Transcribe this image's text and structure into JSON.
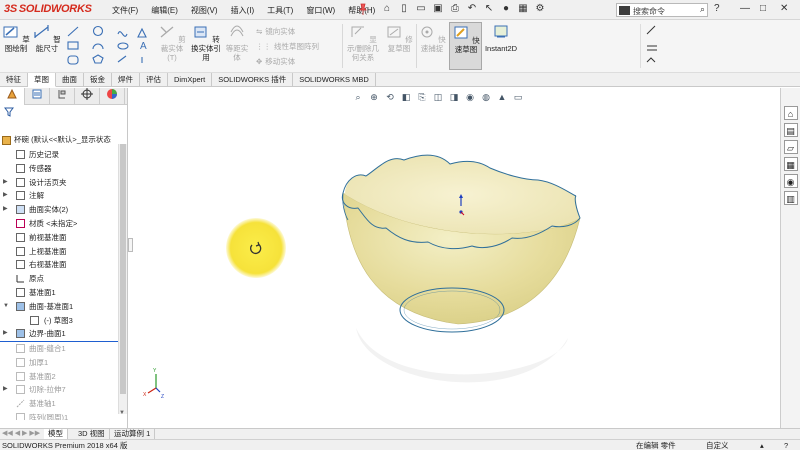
{
  "app": {
    "brand_prefix": "3S",
    "brand": "SOLIDWORKS"
  },
  "menu": [
    "文件(F)",
    "编辑(E)",
    "视图(V)",
    "插入(I)",
    "工具(T)",
    "窗口(W)",
    "帮助(H)"
  ],
  "search": {
    "placeholder": "搜索命令"
  },
  "ribbon": {
    "sketch": "草图绘制",
    "smart_dim": "智能尺寸",
    "mirror_solid": "剪裁实体(T)",
    "convert": "转换实体引用",
    "offset": "等距实体",
    "mirror": "镜向实体",
    "linear_pattern": "线性草图阵列",
    "move": "移动实体",
    "relations": "显示/删除几何关系",
    "repair": "修复草图",
    "quick_snap": "快速捕捉",
    "rapid_sketch": "快速草图",
    "instant2d": "Instant2D"
  },
  "tabs": [
    "特征",
    "草图",
    "曲面",
    "钣金",
    "焊件",
    "评估",
    "DimXpert",
    "SOLIDWORKS 插件",
    "SOLIDWORKS MBD"
  ],
  "tree": {
    "root": "杯碗 (默认<<默认>_显示状态",
    "items": [
      "历史记录",
      "传感器",
      "设计活页夹",
      "注解",
      "曲面实体(2)",
      "材质 <未指定>",
      "前视基准面",
      "上视基准面",
      "右视基准面",
      "原点",
      "基准面1",
      "曲面-基准面1",
      "(-) 草图3",
      "边界-曲面1",
      "曲面-缝合1",
      "加厚1",
      "基准面2",
      "切除-拉伸7",
      "基准轴1",
      "阵列(圆周)1"
    ]
  },
  "bottom_tabs": [
    "模型",
    "3D 视图",
    "运动算例 1"
  ],
  "status": {
    "product": "SOLIDWORKS Premium 2018 x64 版",
    "mode": "在编辑 零件",
    "units": "自定义"
  },
  "colors": {
    "brand_red": "#d52b1e",
    "bowl_fill": "#e8e1a6",
    "bowl_edge": "#2f6f9a",
    "cursor_highlight": "#f6e23a"
  }
}
